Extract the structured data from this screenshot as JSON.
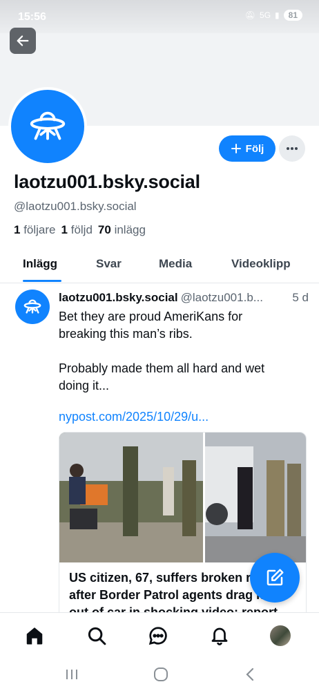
{
  "status_bar": {
    "time": "15:56",
    "network": "5G",
    "battery": "81"
  },
  "profile": {
    "display_name": "laotzu001.bsky.social",
    "handle": "@laotzu001.bsky.social",
    "followers_count": "1",
    "followers_label": "följare",
    "following_count": "1",
    "following_label": "följd",
    "posts_count": "70",
    "posts_label": "inlägg",
    "follow_label": "Följ"
  },
  "tabs": [
    {
      "label": "Inlägg",
      "active": true
    },
    {
      "label": "Svar",
      "active": false
    },
    {
      "label": "Media",
      "active": false
    },
    {
      "label": "Videoklipp",
      "active": false
    }
  ],
  "post": {
    "author": "laotzu001.bsky.social",
    "handle": "@laotzu001.b...",
    "time": "5 d",
    "text_line1": "Bet they are proud AmeriKans for",
    "text_line2": "breaking this man’s ribs.",
    "text_line3": "Probably made them all hard and wet",
    "text_line4": "doing it...",
    "link": "nypost.com/2025/10/29/u...",
    "embed_title": "US citizen, 67, suffers broken ribs after Border Patrol agents drag him out of car in shocking video: report"
  },
  "icons": {
    "back": "arrow-left-icon",
    "more": "ellipsis-icon",
    "compose": "compose-icon",
    "home": "home-icon",
    "search": "search-icon",
    "chat": "chat-icon",
    "notifications": "bell-icon"
  },
  "colors": {
    "accent": "#1083fe",
    "muted": "#5b6570"
  }
}
